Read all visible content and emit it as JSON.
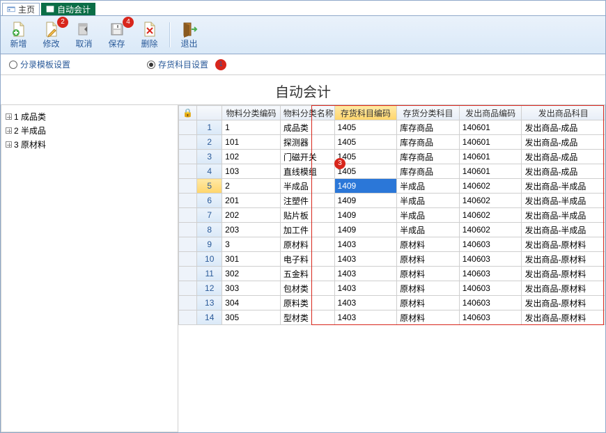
{
  "tabs": {
    "home": "主页",
    "active": "自动会计"
  },
  "toolbar": {
    "new": "新增",
    "edit": "修改",
    "cancel": "取消",
    "save": "保存",
    "delete": "删除",
    "exit": "退出",
    "badges": {
      "edit": "2",
      "save": "4"
    }
  },
  "radios": {
    "template": "分录模板设置",
    "inventory": "存货科目设置",
    "selected": "inventory",
    "callout": "1"
  },
  "page_title": "自动会计",
  "tree": [
    {
      "id": "1",
      "label": "成品类"
    },
    {
      "id": "2",
      "label": "半成品"
    },
    {
      "id": "3",
      "label": "原材料"
    }
  ],
  "grid": {
    "lock_header": "🔒",
    "headers": [
      "物料分类编码",
      "物料分类名称",
      "存货科目编码",
      "存货分类科目",
      "发出商品编码",
      "发出商品科目"
    ],
    "highlight_col": 2,
    "callout_col": "3",
    "selected_row": 4,
    "rows": [
      [
        "1",
        "成品类",
        "1405",
        "库存商品",
        "140601",
        "发出商品-成品"
      ],
      [
        "101",
        "探测器",
        "1405",
        "库存商品",
        "140601",
        "发出商品-成品"
      ],
      [
        "102",
        "门磁开关",
        "1405",
        "库存商品",
        "140601",
        "发出商品-成品"
      ],
      [
        "103",
        "直线模组",
        "1405",
        "库存商品",
        "140601",
        "发出商品-成品"
      ],
      [
        "2",
        "半成品",
        "1409",
        "半成品",
        "140602",
        "发出商品-半成品"
      ],
      [
        "201",
        "注塑件",
        "1409",
        "半成品",
        "140602",
        "发出商品-半成品"
      ],
      [
        "202",
        "贴片板",
        "1409",
        "半成品",
        "140602",
        "发出商品-半成品"
      ],
      [
        "203",
        "加工件",
        "1409",
        "半成品",
        "140602",
        "发出商品-半成品"
      ],
      [
        "3",
        "原材料",
        "1403",
        "原材料",
        "140603",
        "发出商品-原材料"
      ],
      [
        "301",
        "电子料",
        "1403",
        "原材料",
        "140603",
        "发出商品-原材料"
      ],
      [
        "302",
        "五金料",
        "1403",
        "原材料",
        "140603",
        "发出商品-原材料"
      ],
      [
        "303",
        "包材类",
        "1403",
        "原材料",
        "140603",
        "发出商品-原材料"
      ],
      [
        "304",
        "原料类",
        "1403",
        "原材料",
        "140603",
        "发出商品-原材料"
      ],
      [
        "305",
        "型材类",
        "1403",
        "原材料",
        "140603",
        "发出商品-原材料"
      ]
    ]
  }
}
